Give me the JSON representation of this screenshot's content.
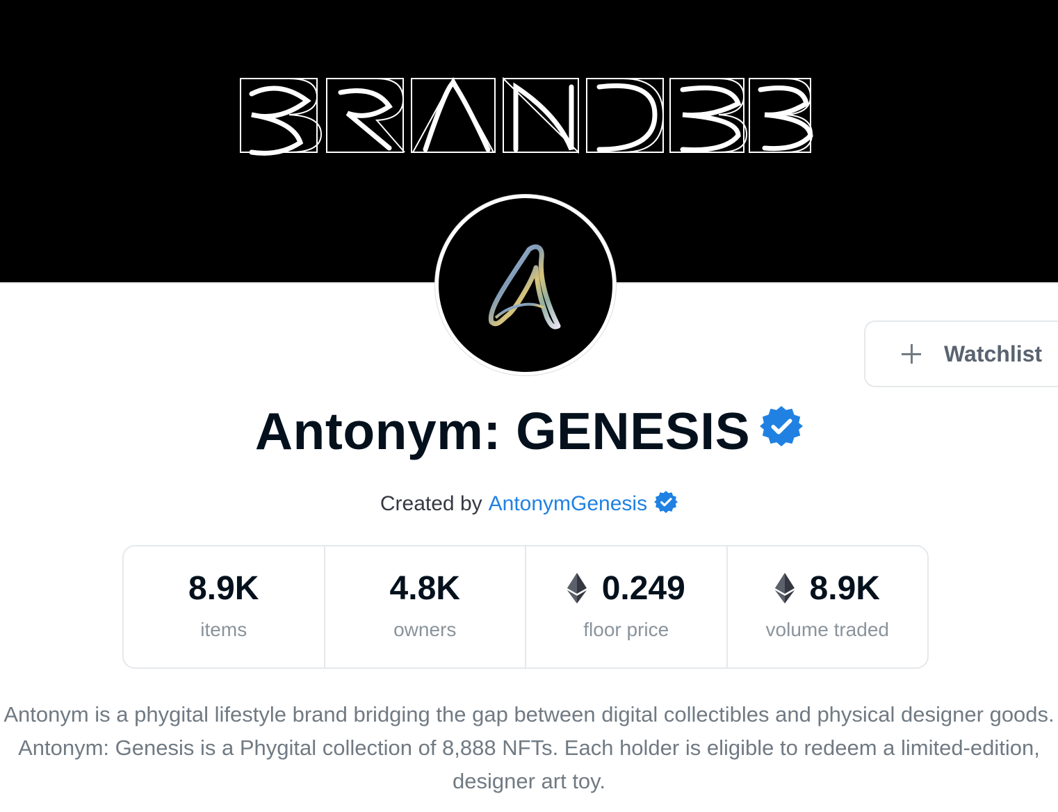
{
  "banner": {
    "wordmark_icon": "antonym-wordmark-art"
  },
  "avatar": {
    "icon": "antonym-a-logo"
  },
  "watchlist": {
    "icon": "plus-icon",
    "label": "Watchlist"
  },
  "collection": {
    "title": "Antonym: GENESIS",
    "verified_icon": "verified-badge-icon",
    "creator_prefix": "Created by",
    "creator_name": "AntonymGenesis"
  },
  "stats": [
    {
      "value": "8.9K",
      "label": "items",
      "icon": ""
    },
    {
      "value": "4.8K",
      "label": "owners",
      "icon": ""
    },
    {
      "value": "0.249",
      "label": "floor price",
      "icon": "ethereum-icon"
    },
    {
      "value": "8.9K",
      "label": "volume traded",
      "icon": "ethereum-icon"
    }
  ],
  "description": "Antonym is a phygital lifestyle brand bridging the gap between digital collectibles and physical designer goods. Antonym: Genesis is a Phygital collection of 8,888 NFTs. Each holder is eligible to redeem a limited-edition, designer art toy.",
  "colors": {
    "accent": "#2081e2",
    "verified": "#2081e2",
    "title": "#04111d",
    "muted": "#707a83",
    "border": "#e5e8eb"
  }
}
